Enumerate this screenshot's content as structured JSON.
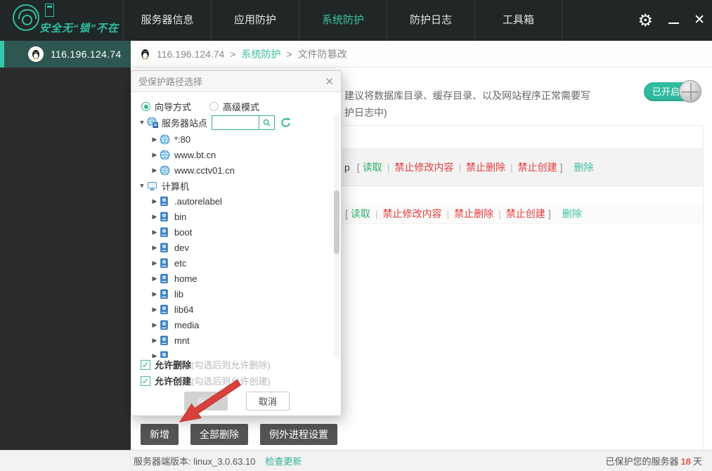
{
  "topbar": {
    "slogan": "安全无“锁”不在",
    "nav": [
      {
        "id": "server-info",
        "label": "服务器信息",
        "active": false
      },
      {
        "id": "app-protect",
        "label": "应用防护",
        "active": false
      },
      {
        "id": "sys-protect",
        "label": "系统防护",
        "active": true
      },
      {
        "id": "protect-log",
        "label": "防护日志",
        "active": false
      },
      {
        "id": "toolbox",
        "label": "工具箱",
        "active": false
      }
    ]
  },
  "window": {
    "minimize": "",
    "close": "✕"
  },
  "sidebar": {
    "server_ip": "116.196.124.74"
  },
  "breadcrumb": {
    "ip": "116.196.124.74",
    "sep": ">",
    "section": "系统防护",
    "page": "文件防篡改"
  },
  "content": {
    "desc_line1": "建议将数据库目录、缓存目录、以及网站程序正常需要写",
    "desc_line2": "护日志中)",
    "toggle_label": "已开启",
    "rows": [
      {
        "path_tail": "p",
        "open": "[",
        "close": "]",
        "sep": "|",
        "delete_label": "删除",
        "actions": [
          {
            "label": "读取",
            "kind": "allow"
          },
          {
            "label": "禁止修改内容",
            "kind": "deny"
          },
          {
            "label": "禁止删除",
            "kind": "deny"
          },
          {
            "label": "禁止创建",
            "kind": "deny"
          }
        ]
      },
      {
        "path_tail": "",
        "open": "[",
        "close": "]",
        "sep": "|",
        "delete_label": "删除",
        "actions": [
          {
            "label": "读取",
            "kind": "allow"
          },
          {
            "label": "禁止修改内容",
            "kind": "deny"
          },
          {
            "label": "禁止删除",
            "kind": "deny"
          },
          {
            "label": "禁止创建",
            "kind": "deny"
          }
        ]
      }
    ],
    "buttons": [
      {
        "id": "add",
        "label": "新增"
      },
      {
        "id": "delete-all",
        "label": "全部删除"
      },
      {
        "id": "exception-process",
        "label": "例外进程设置"
      }
    ]
  },
  "modal": {
    "title": "受保护路径选择",
    "close": "✕",
    "radios": [
      {
        "id": "wizard-mode",
        "label": "向导方式",
        "selected": true
      },
      {
        "id": "advanced-mode",
        "label": "高级模式",
        "selected": false
      }
    ],
    "search_placeholder": "",
    "tree": [
      {
        "id": "server-sites",
        "label": "服务器站点",
        "icon": "globe-server",
        "level": 0,
        "expanded": true,
        "has_search": true
      },
      {
        "id": "site-80",
        "label": "*:80",
        "icon": "globe",
        "level": 1,
        "expanded": false
      },
      {
        "id": "site-btcn",
        "label": "www.bt.cn",
        "icon": "globe",
        "level": 1,
        "expanded": false
      },
      {
        "id": "site-cctv01",
        "label": "www.cctv01.cn",
        "icon": "globe",
        "level": 1,
        "expanded": false
      },
      {
        "id": "computer",
        "label": "计算机",
        "icon": "computer",
        "level": 0,
        "expanded": true
      },
      {
        "id": "autorelabel",
        "label": ".autorelabel",
        "icon": "drive",
        "level": 1,
        "expanded": false
      },
      {
        "id": "bin",
        "label": "bin",
        "icon": "drive",
        "level": 1,
        "expanded": false
      },
      {
        "id": "boot",
        "label": "boot",
        "icon": "drive",
        "level": 1,
        "expanded": false
      },
      {
        "id": "dev",
        "label": "dev",
        "icon": "drive",
        "level": 1,
        "expanded": false
      },
      {
        "id": "etc",
        "label": "etc",
        "icon": "drive",
        "level": 1,
        "expanded": false
      },
      {
        "id": "home",
        "label": "home",
        "icon": "drive",
        "level": 1,
        "expanded": false
      },
      {
        "id": "lib",
        "label": "lib",
        "icon": "drive",
        "level": 1,
        "expanded": false
      },
      {
        "id": "lib64",
        "label": "lib64",
        "icon": "drive",
        "level": 1,
        "expanded": false
      },
      {
        "id": "media",
        "label": "media",
        "icon": "drive",
        "level": 1,
        "expanded": false
      },
      {
        "id": "mnt",
        "label": "mnt",
        "icon": "drive",
        "level": 1,
        "expanded": false
      },
      {
        "id": "partial",
        "label": "",
        "icon": "drive",
        "level": 1,
        "expanded": false
      }
    ],
    "checkboxes": [
      {
        "id": "allow-delete",
        "label": "允许删除",
        "hint": "(勾选后则允许删除)",
        "checked": true
      },
      {
        "id": "allow-create",
        "label": "允许创建",
        "hint": "(勾选后则允许创建)",
        "checked": true
      }
    ],
    "save_label": "保存",
    "cancel_label": "取消"
  },
  "statusbar": {
    "version_label": "服务器端版本: linux_3.0.63.10",
    "check_update": "检查更新",
    "protected_prefix": "已保护您的服务器",
    "protected_days": "18",
    "protected_suffix": "天"
  },
  "colors": {
    "accent_teal": "#2fbfa3",
    "nav_active": "#3ac49e",
    "deny_red": "#e23b3b",
    "allow_green": "#2fac62",
    "delete_link": "#3fc0a2",
    "days_red": "#e0614a",
    "topbar_bg": "#212626",
    "sidebar_bg": "#2a2c2e",
    "selected_item_bg": "#2f5751"
  }
}
